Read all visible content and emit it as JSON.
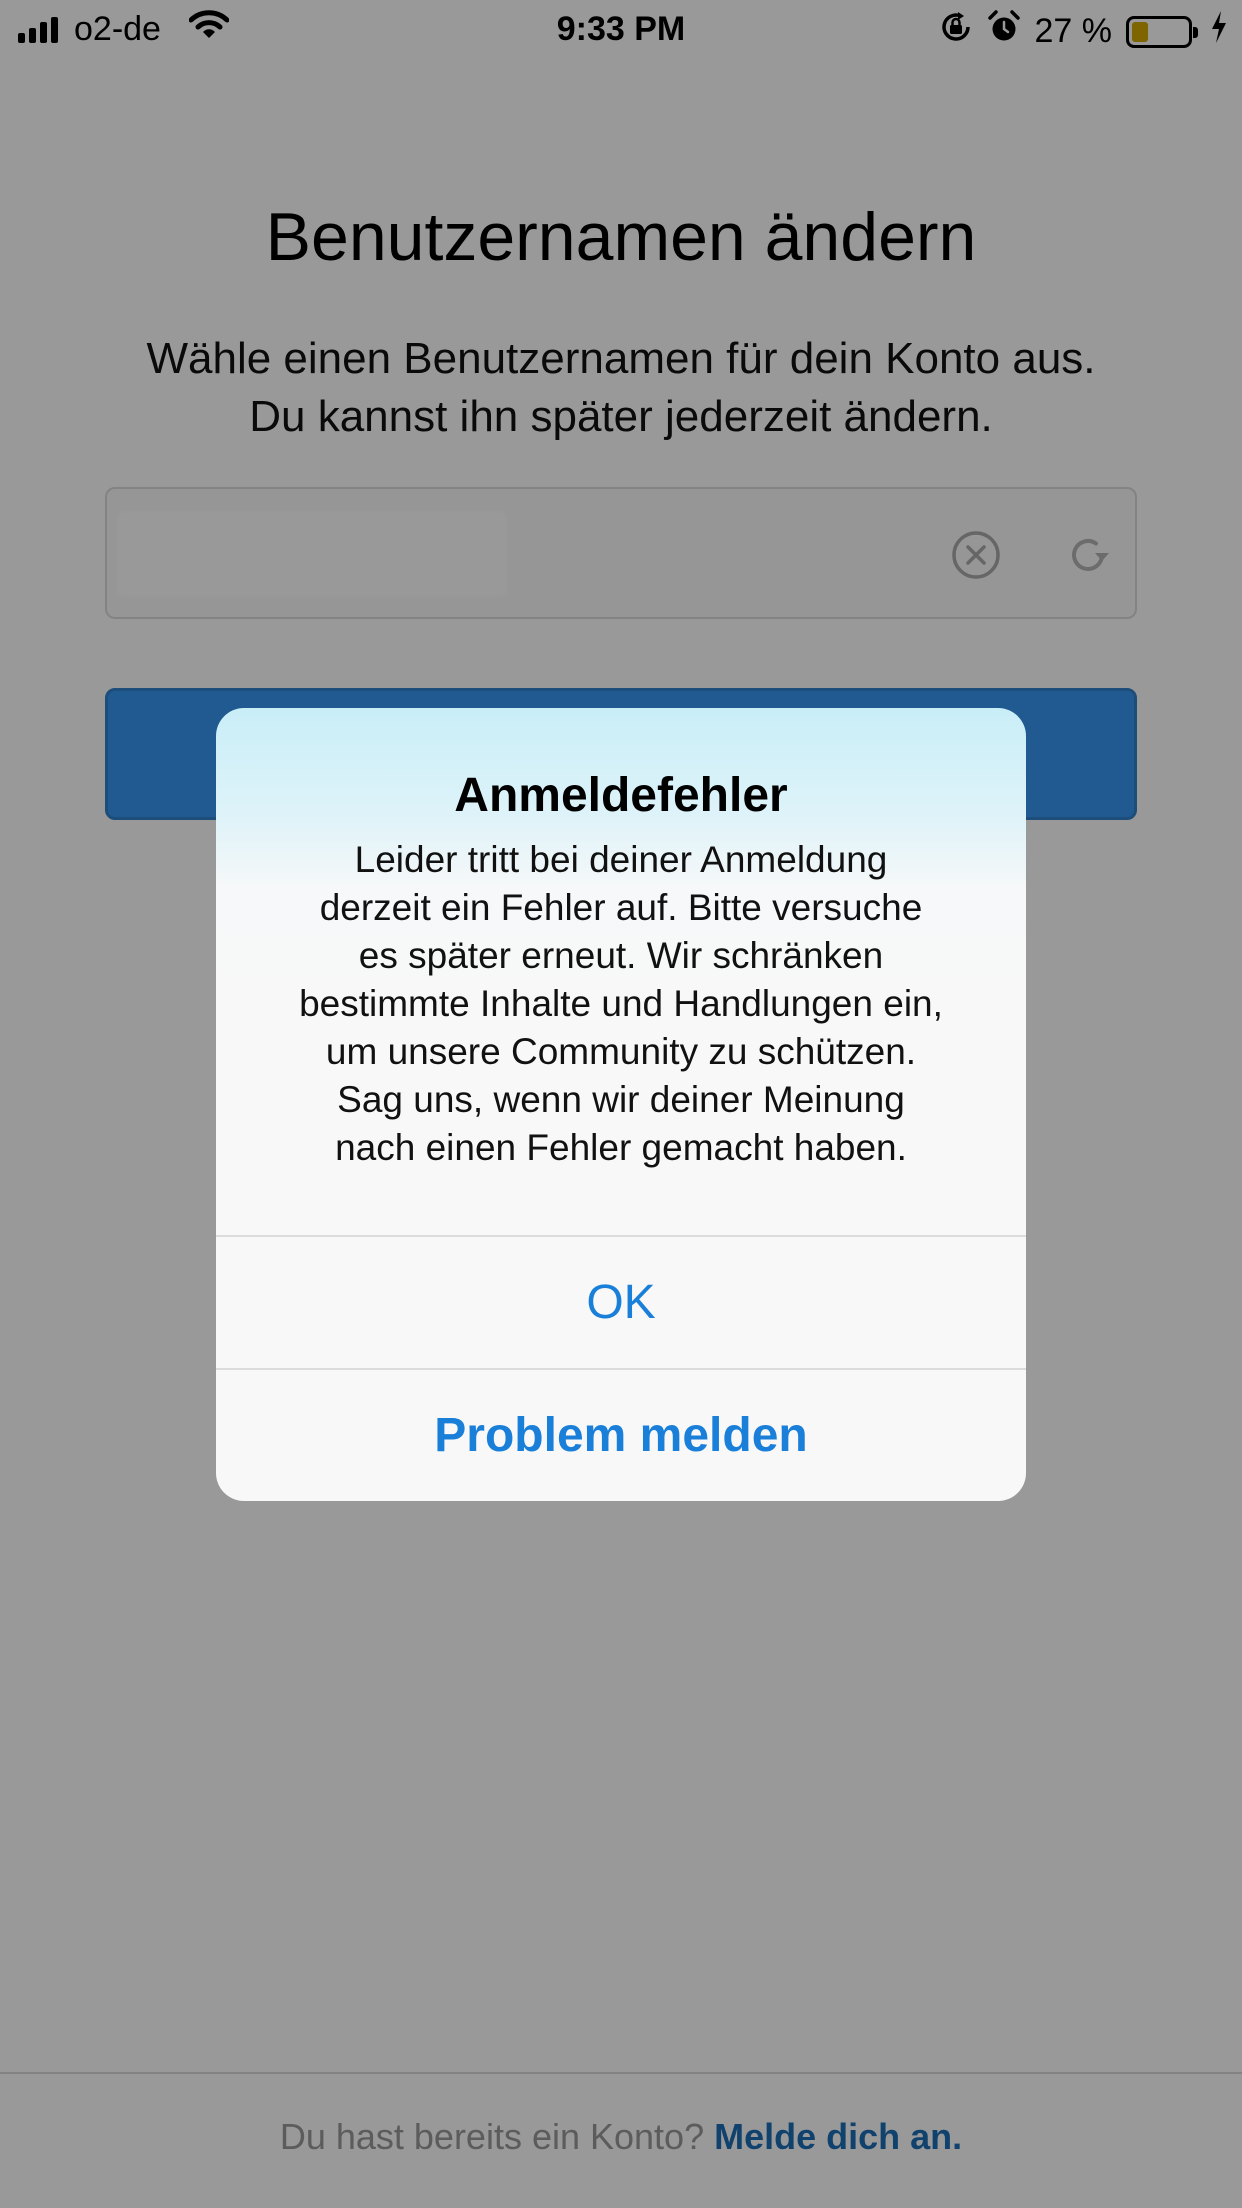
{
  "status_bar": {
    "carrier": "o2-de",
    "time": "9:33 PM",
    "battery_percent": "27 %",
    "battery_level": 0.27,
    "icons": [
      "signal-icon",
      "wifi-icon",
      "orientation-lock-icon",
      "alarm-icon",
      "battery-icon",
      "charging-icon"
    ]
  },
  "screen": {
    "title": "Benutzernamen ändern",
    "subtitle": "Wähle einen Benutzernamen für dein Konto aus. Du kannst ihn später jederzeit ändern.",
    "username_field": {
      "value": "",
      "icons": [
        "clear-icon",
        "refresh-icon"
      ]
    },
    "footer": {
      "text": "Du hast bereits ein Konto?",
      "link": "Melde dich an."
    }
  },
  "alert": {
    "title": "Anmeldefehler",
    "message_lines": [
      "Leider tritt bei deiner Anmeldung",
      "derzeit ein Fehler auf. Bitte versuche",
      "es später erneut. Wir schränken",
      "bestimmte Inhalte und Handlungen ein,",
      "um unsere Community zu schützen.",
      "Sag uns, wenn wir deiner Meinung",
      "nach einen Fehler gemacht haben."
    ],
    "ok_label": "OK",
    "report_label": "Problem melden"
  },
  "colors": {
    "accent": "#1a7fd9",
    "button_blue": "#3897f0",
    "battery_fill": "#d4a800",
    "link": "#1d6fb8"
  }
}
